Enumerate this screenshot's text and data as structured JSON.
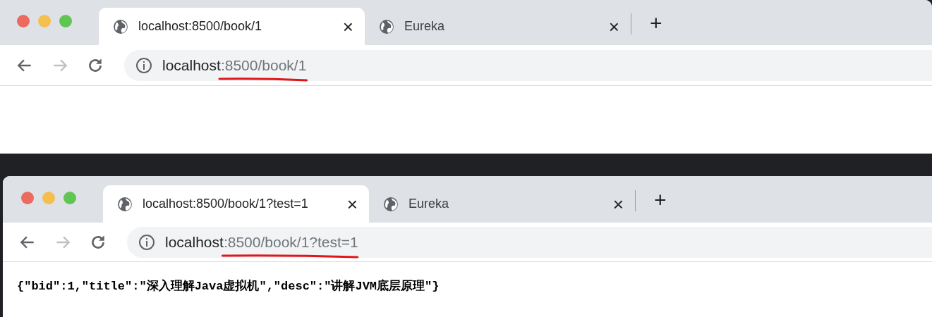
{
  "windows": [
    {
      "tabs": [
        {
          "title": "localhost:8500/book/1",
          "close": "×",
          "selected": true
        },
        {
          "title": "Eureka",
          "close": "×",
          "selected": false
        }
      ],
      "new_tab": "+",
      "forward_disabled": true,
      "address": {
        "host": "localhost",
        "path": ":8500/book/1",
        "underlined": true
      }
    },
    {
      "tabs": [
        {
          "title": "localhost:8500/book/1?test=1",
          "close": "×",
          "selected": true
        },
        {
          "title": "Eureka",
          "close": "×",
          "selected": false
        }
      ],
      "new_tab": "+",
      "forward_disabled": true,
      "address": {
        "host": "localhost",
        "path": ":8500/book/1?test=1",
        "underlined": true
      },
      "body_text": "{\"bid\":1,\"title\":\"深入理解Java虚拟机\",\"desc\":\"讲解JVM底层原理\"}"
    }
  ]
}
